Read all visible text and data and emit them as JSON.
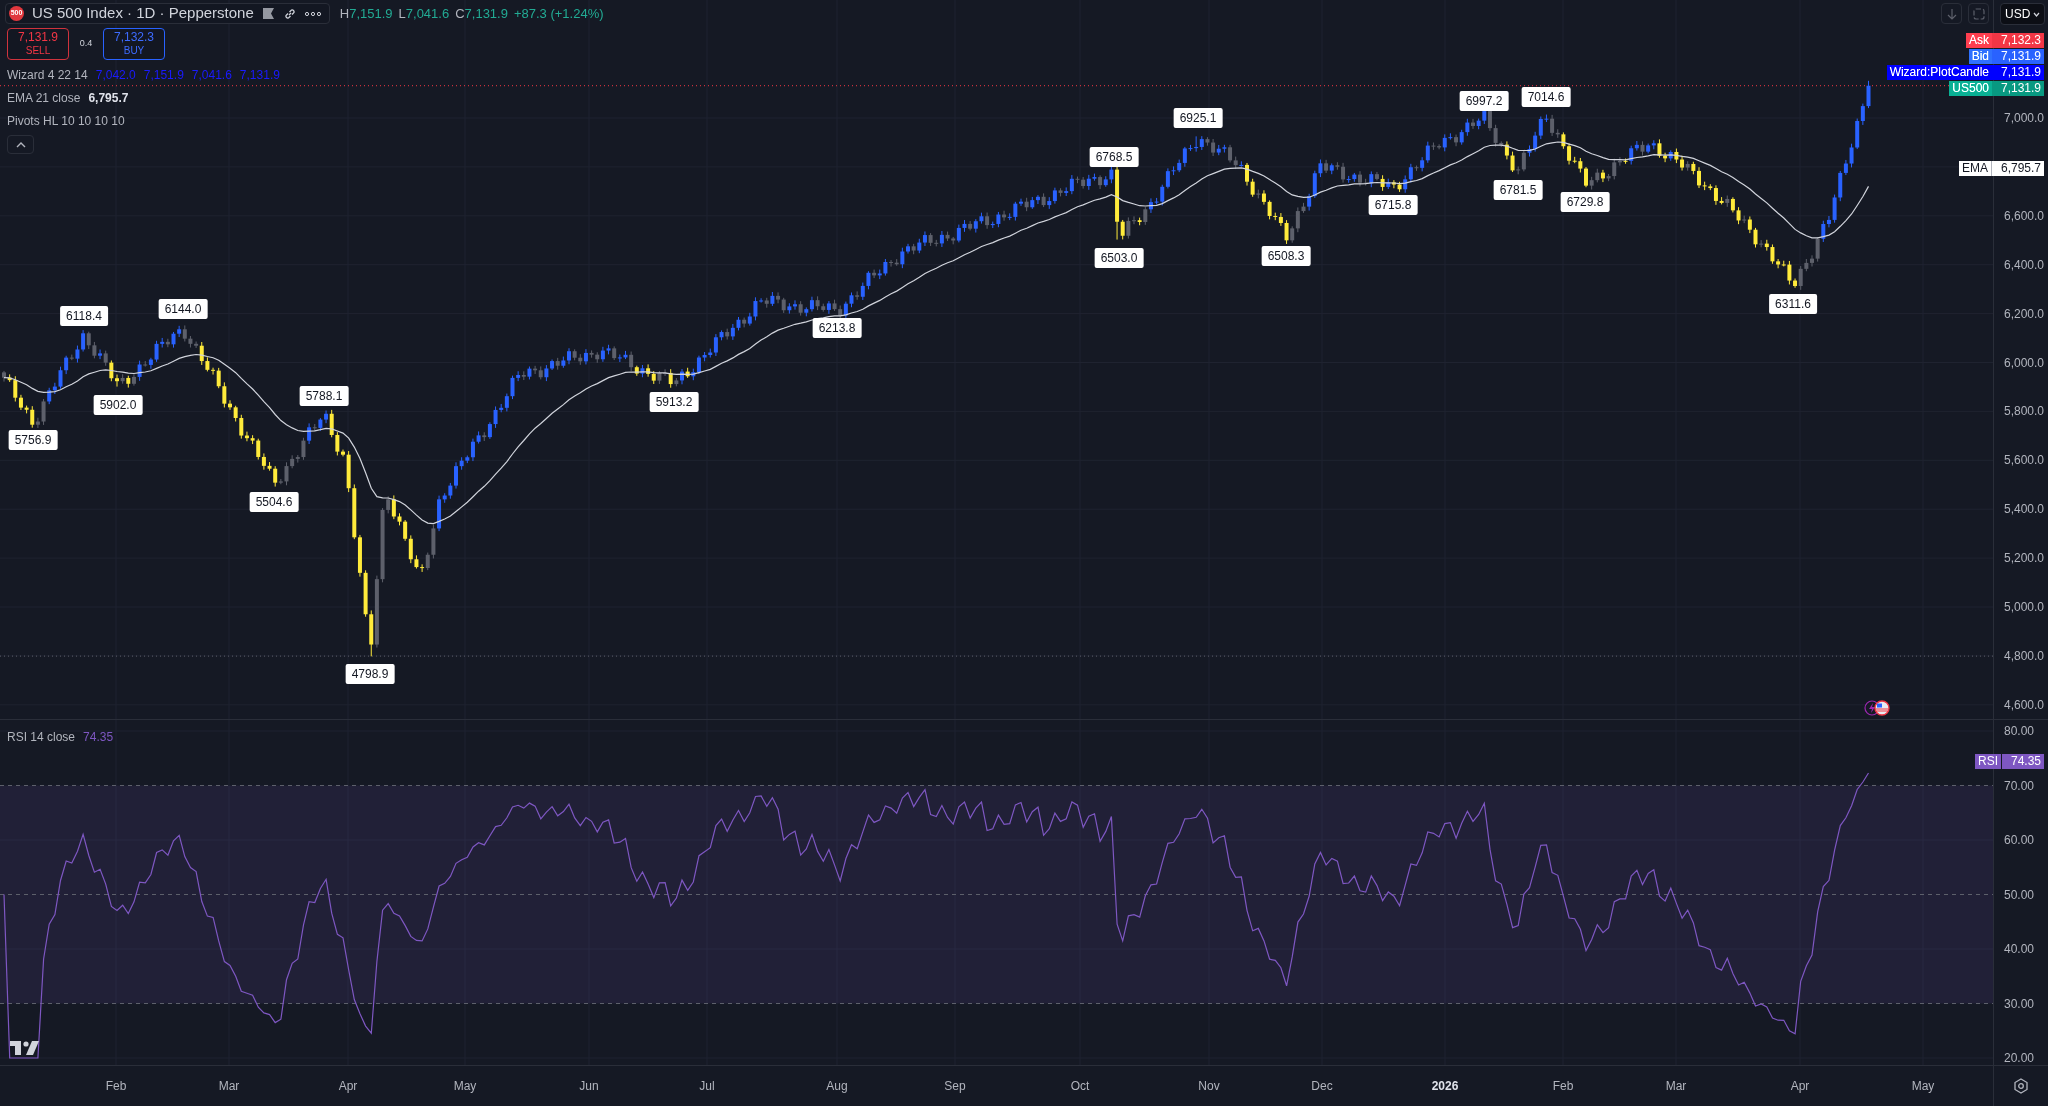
{
  "header": {
    "badge": "500",
    "title": "US 500 Index · 1D · Pepperstone",
    "ohlc": [
      {
        "label": "H",
        "value": "7,151.9"
      },
      {
        "label": "L",
        "value": "7,041.6"
      },
      {
        "label": "C",
        "value": "7,131.9"
      }
    ],
    "change": "+87.3 (+1.24%)"
  },
  "trade": {
    "sell_price": "7,131.9",
    "sell_label": "SELL",
    "spread": "0.4",
    "buy_price": "7,132.3",
    "buy_label": "BUY"
  },
  "legend": [
    {
      "name": "Wizard 4 22 14",
      "values": [
        "7,042.0",
        "7,151.9",
        "7,041.6",
        "7,131.9"
      ],
      "kind": "wizard"
    },
    {
      "name": "EMA 21 close",
      "values": [
        "6,795.7"
      ],
      "kind": "ema"
    },
    {
      "name": "Pivots HL 10 10 10 10",
      "kind": "pivots"
    }
  ],
  "currency": "USD",
  "price_tags": [
    {
      "name": "Ask",
      "value": "7,132.3",
      "color": "#f23645"
    },
    {
      "name": "Bid",
      "value": "7,131.9",
      "color": "#2962ff"
    },
    {
      "name": "Wizard:PlotCandle",
      "value": "7,131.9",
      "color": "#0000ff"
    },
    {
      "name": "US500",
      "value": "7,131.9",
      "color": "#089981"
    }
  ],
  "ema_tag": {
    "name": "EMA",
    "value": "6,795.7"
  },
  "price_axis": [
    "7,000.0",
    "6,600.0",
    "6,400.0",
    "6,200.0",
    "6,000.0",
    "5,800.0",
    "5,600.0",
    "5,400.0",
    "5,200.0",
    "5,000.0",
    "4,800.0",
    "4,600.0"
  ],
  "pivots": [
    {
      "text": "5756.9",
      "kind": "low"
    },
    {
      "text": "6118.4",
      "kind": "high"
    },
    {
      "text": "5902.0",
      "kind": "low"
    },
    {
      "text": "6144.0",
      "kind": "high"
    },
    {
      "text": "5504.6",
      "kind": "low"
    },
    {
      "text": "5788.1",
      "kind": "high"
    },
    {
      "text": "4798.9",
      "kind": "low"
    },
    {
      "text": "5913.2",
      "kind": "low"
    },
    {
      "text": "6213.8",
      "kind": "low"
    },
    {
      "text": "6768.5",
      "kind": "high"
    },
    {
      "text": "6503.0",
      "kind": "low"
    },
    {
      "text": "6925.1",
      "kind": "high"
    },
    {
      "text": "6508.3",
      "kind": "low"
    },
    {
      "text": "6715.8",
      "kind": "low"
    },
    {
      "text": "6997.2",
      "kind": "high"
    },
    {
      "text": "6781.5",
      "kind": "low"
    },
    {
      "text": "7014.6",
      "kind": "high"
    },
    {
      "text": "6729.8",
      "kind": "low"
    },
    {
      "text": "6311.6",
      "kind": "low"
    }
  ],
  "rsi": {
    "title": "RSI 14 close",
    "value": "74.35",
    "tag": "RSI",
    "tag_value": "74.35",
    "axis": [
      "80.00",
      "70.00",
      "60.00",
      "50.00",
      "40.00",
      "30.00",
      "20.00"
    ]
  },
  "time_axis": [
    {
      "label": "Feb",
      "kind": "month"
    },
    {
      "label": "Mar",
      "kind": "month"
    },
    {
      "label": "Apr",
      "kind": "month"
    },
    {
      "label": "May",
      "kind": "month"
    },
    {
      "label": "Jun",
      "kind": "month"
    },
    {
      "label": "Jul",
      "kind": "month"
    },
    {
      "label": "Aug",
      "kind": "month"
    },
    {
      "label": "Sep",
      "kind": "month"
    },
    {
      "label": "Oct",
      "kind": "month"
    },
    {
      "label": "Nov",
      "kind": "month"
    },
    {
      "label": "Dec",
      "kind": "month"
    },
    {
      "label": "2026",
      "kind": "year"
    },
    {
      "label": "Feb",
      "kind": "month"
    },
    {
      "label": "Mar",
      "kind": "month"
    },
    {
      "label": "Apr",
      "kind": "month"
    },
    {
      "label": "May",
      "kind": "month"
    }
  ]
}
